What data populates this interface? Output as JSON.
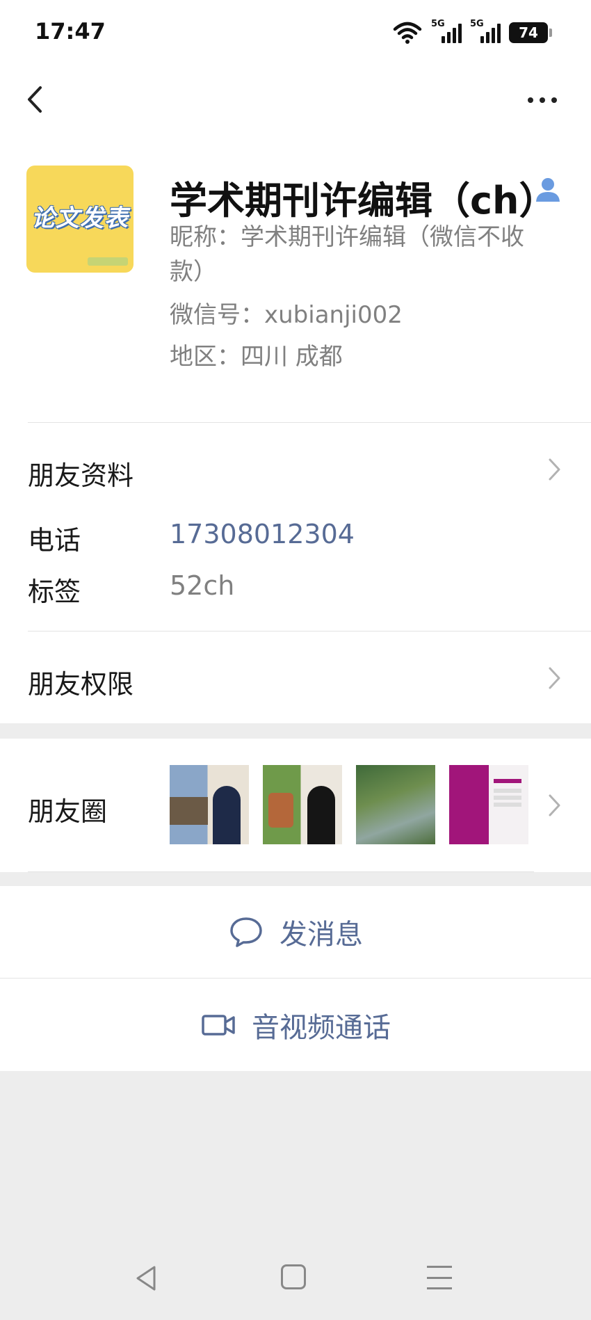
{
  "status_bar": {
    "time": "17:47",
    "signal_labels": [
      "5G",
      "5G"
    ],
    "battery": "74"
  },
  "profile": {
    "avatar_text": "论文发表",
    "name": "学术期刊许编辑（ch）",
    "nickname": "昵称：学术期刊许编辑（微信不收款）",
    "wechat_id": "微信号：xubianji002",
    "region": "地区：四川  成都"
  },
  "friend_info": {
    "label": "朋友资料"
  },
  "details": {
    "phone_label": "电话",
    "phone_value": "17308012304",
    "tag_label": "标签",
    "tag_value": "52ch"
  },
  "friend_permissions": {
    "label": "朋友权限"
  },
  "moments": {
    "label": "朋友圈",
    "thumbnails": [
      "moment-photo-1",
      "moment-photo-2",
      "moment-photo-3",
      "moment-photo-4"
    ]
  },
  "actions": {
    "message": "发消息",
    "call": "音视频通话"
  },
  "colors": {
    "link": "#576b95",
    "secondary_text": "#808080",
    "background": "#ededed",
    "verified": "#6a9be0"
  },
  "icons": [
    "back-arrow-icon",
    "more-icon",
    "verified-user-icon",
    "chevron-right-icon",
    "chat-bubble-icon",
    "video-camera-icon"
  ]
}
